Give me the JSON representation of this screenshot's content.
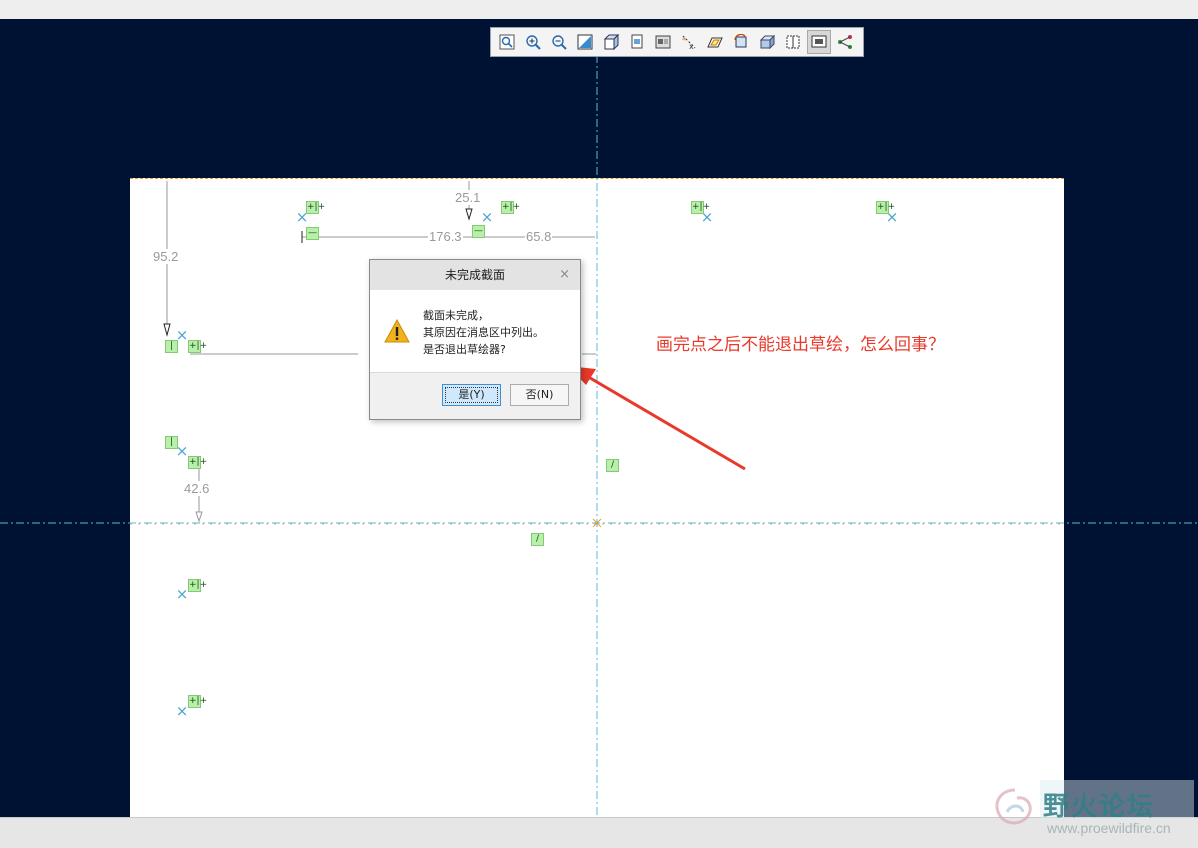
{
  "toolbar": {
    "buttons": [
      {
        "name": "refit-icon"
      },
      {
        "name": "zoom-in-icon"
      },
      {
        "name": "zoom-out-icon"
      },
      {
        "name": "repaint-icon"
      },
      {
        "name": "display-style-icon"
      },
      {
        "name": "saved-orientations-icon"
      },
      {
        "name": "view-manager-icon"
      },
      {
        "name": "datum-display-icon"
      },
      {
        "name": "sketch-view-icon"
      },
      {
        "name": "reorient-icon"
      },
      {
        "name": "view-3d-icon"
      },
      {
        "name": "sketcher-display-icon"
      },
      {
        "name": "dimension-display-icon",
        "active": true
      },
      {
        "name": "constraint-display-icon"
      }
    ]
  },
  "sketch": {
    "dimensions": [
      "25.1",
      "176.3",
      "65.8",
      "95.2",
      "42.6"
    ],
    "constraint_symbols": [
      "+|+",
      "—",
      "|",
      "/"
    ]
  },
  "dialog": {
    "title": "未完成截面",
    "close": "×",
    "message_lines": [
      "截面未完成，",
      "其原因在消息区中列出。",
      "是否退出草绘器?"
    ],
    "yes_label": "是(Y)",
    "no_label": "否(N)"
  },
  "annotation": {
    "text": "画完点之后不能退出草绘，怎么回事？",
    "color": "#e8392b"
  },
  "watermark": {
    "title": "野火论坛",
    "url": "www.proewildfire.cn"
  },
  "colors": {
    "background": "#001233",
    "sheet": "#ffffff",
    "centerline": "#5bb4d8",
    "constraint": "#b7f0a8"
  }
}
